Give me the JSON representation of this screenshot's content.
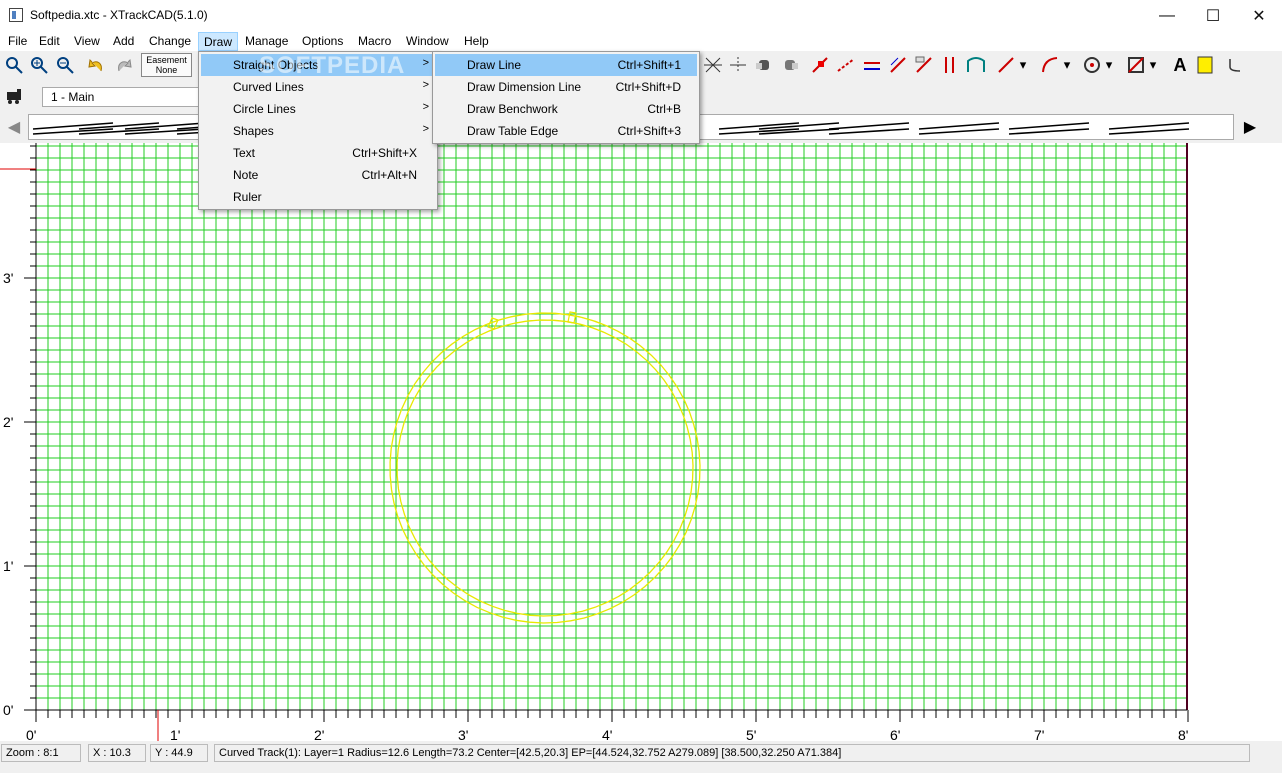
{
  "window": {
    "title": "Softpedia.xtc - XTrackCAD(5.1.0)",
    "minimize": "—",
    "maximize": "☐",
    "close": "✕"
  },
  "menubar": {
    "items": [
      "File",
      "Edit",
      "View",
      "Add",
      "Change",
      "Draw",
      "Manage",
      "Options",
      "Macro",
      "Window",
      "Help"
    ],
    "active": "Draw"
  },
  "toolbar": {
    "easement_label": "Easement",
    "easement_value": "None",
    "layer": "1 - Main"
  },
  "draw_menu": {
    "items": [
      {
        "label": "Straight Objects",
        "shortcut": "",
        "submenu": true
      },
      {
        "label": "Curved Lines",
        "shortcut": "",
        "submenu": true
      },
      {
        "label": "Circle Lines",
        "shortcut": "",
        "submenu": true
      },
      {
        "label": "Shapes",
        "shortcut": "",
        "submenu": true
      },
      {
        "label": "Text",
        "shortcut": "Ctrl+Shift+X",
        "submenu": false
      },
      {
        "label": "Note",
        "shortcut": "Ctrl+Alt+N",
        "submenu": false
      },
      {
        "label": "Ruler",
        "shortcut": "",
        "submenu": false
      }
    ]
  },
  "straight_submenu": {
    "items": [
      {
        "label": "Draw Line",
        "shortcut": "Ctrl+Shift+1"
      },
      {
        "label": "Draw Dimension Line",
        "shortcut": "Ctrl+Shift+D"
      },
      {
        "label": "Draw Benchwork",
        "shortcut": "Ctrl+B"
      },
      {
        "label": "Draw Table Edge",
        "shortcut": "Ctrl+Shift+3"
      }
    ]
  },
  "watermark": "SOFTPEDIA",
  "ruler": {
    "x_labels": [
      "0'",
      "1'",
      "2'",
      "3'",
      "4'",
      "5'",
      "6'",
      "7'",
      "8'"
    ],
    "y_labels": [
      "0'",
      "1'",
      "2'",
      "3'"
    ]
  },
  "status": {
    "zoom": "Zoom : 8:1",
    "x": "X : 10.3",
    "y": "Y : 44.9",
    "message": "Curved Track(1): Layer=1 Radius=12.6 Length=73.2 Center=[42.5,20.3] EP=[44.524,32.752 A279.089] [38.500,32.250 A71.384]"
  },
  "colors": {
    "grid": "#22cc22",
    "track": "#e8e800",
    "menu_highlight": "#91c9f7"
  }
}
